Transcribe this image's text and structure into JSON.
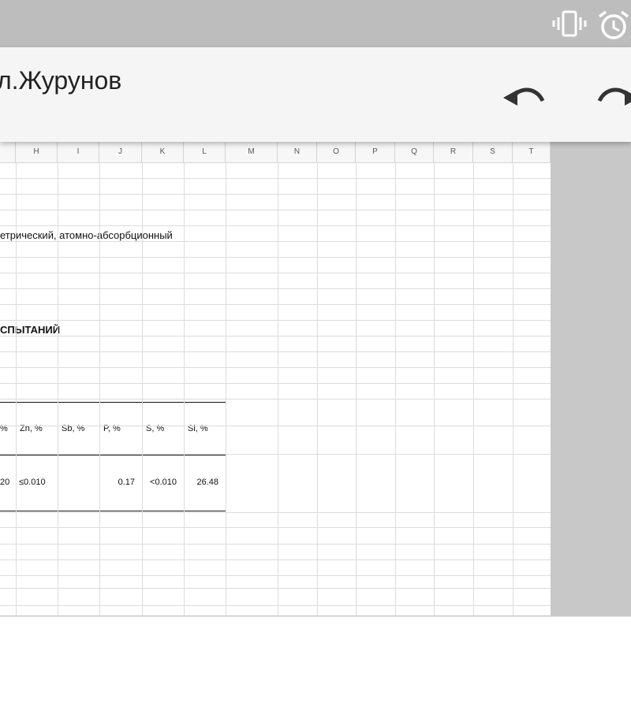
{
  "app": {
    "title": "л.Журунов"
  },
  "status_icons": [
    "vibrate-icon",
    "alarm-icon"
  ],
  "toolbar": {
    "undo_icon": "undo-icon",
    "redo_icon": "redo-icon"
  },
  "sheet": {
    "columns": [
      "H",
      "I",
      "J",
      "K",
      "L",
      "M",
      "N",
      "O",
      "P",
      "Q",
      "R",
      "S",
      "T"
    ],
    "method_text": "етрический, атомно-абсорбционный",
    "section_heading": "СПЫТАНИЙ",
    "results_table": {
      "headers": [
        "%",
        "Zn,  %",
        "Sb,  %",
        "P,  %",
        "S,  %",
        "Si,  %"
      ],
      "values": [
        "20",
        "≤0.010",
        "",
        "0.17",
        "<0.010",
        "26.48"
      ]
    }
  },
  "colors": {
    "statusbar": "#bdbdbd",
    "appbar": "#f5f5f5",
    "sheet_background": "#c8c8c8",
    "gridline": "#dcdcdc"
  }
}
